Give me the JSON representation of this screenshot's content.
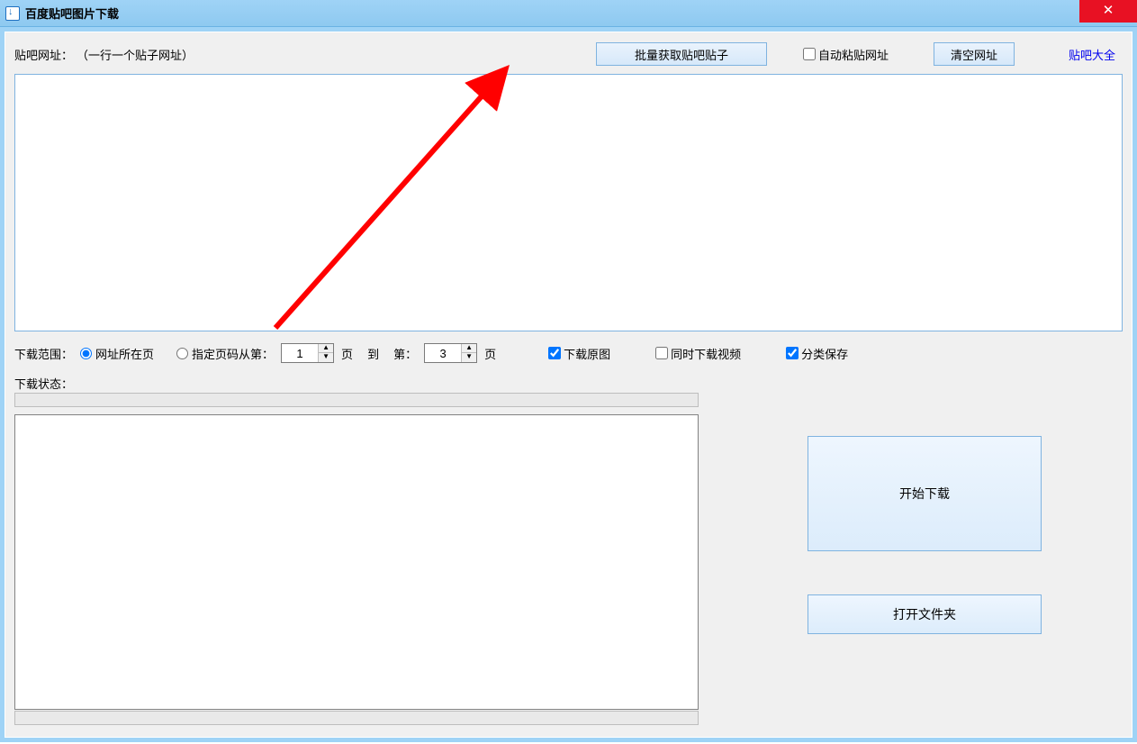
{
  "window": {
    "title": "百度贴吧图片下载"
  },
  "toolbar": {
    "url_label": "贴吧网址：",
    "url_hint": "（一行一个贴子网址）",
    "batch_get_label": "批量获取贴吧贴子",
    "auto_paste_label": "自动粘贴网址",
    "auto_paste_checked": false,
    "clear_label": "清空网址",
    "all_tieba_link_label": "贴吧大全"
  },
  "urls_textarea_value": "",
  "range": {
    "label": "下载范围：",
    "radio_current_label": "网址所在页",
    "radio_pages_label": "指定页码从第：",
    "selected": "current",
    "from_value": "1",
    "mid_text_1": "页",
    "mid_text_2": "到",
    "mid_text_3": "第：",
    "to_value": "3",
    "tail_text": "页",
    "download_original_label": "下载原图",
    "download_original_checked": true,
    "download_video_label": "同时下载视频",
    "download_video_checked": false,
    "categorize_save_label": "分类保存",
    "categorize_save_checked": true
  },
  "status": {
    "label": "下载状态："
  },
  "log_text": "",
  "buttons": {
    "start_label": "开始下载",
    "open_folder_label": "打开文件夹"
  }
}
